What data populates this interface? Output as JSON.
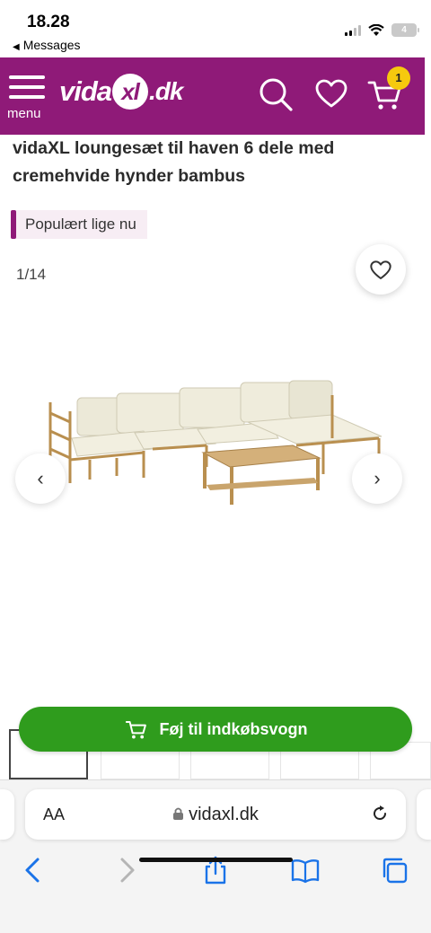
{
  "status": {
    "time": "18.28",
    "back_label": "Messages",
    "battery": "4"
  },
  "header": {
    "menu_label": "menu",
    "logo_main": "vida",
    "logo_xl": "xl",
    "logo_domain": ".dk",
    "cart_count": "1",
    "brand_color": "#8f1a78"
  },
  "product": {
    "title": "vidaXL loungesæt til haven 6 dele med cremehvide hynder bambus",
    "badge": "Populært lige nu",
    "image_counter": "1/14"
  },
  "actions": {
    "add_to_cart": "Føj til indkøbsvogn",
    "button_color": "#2f9c1d"
  },
  "browser": {
    "text_size": "AA",
    "url": "vidaxl.dk"
  },
  "icons": [
    "menu-icon",
    "search-icon",
    "heart-icon",
    "cart-icon",
    "chevron-left-icon",
    "chevron-right-icon",
    "lock-icon",
    "reload-icon",
    "share-icon",
    "book-icon",
    "tabs-icon"
  ]
}
